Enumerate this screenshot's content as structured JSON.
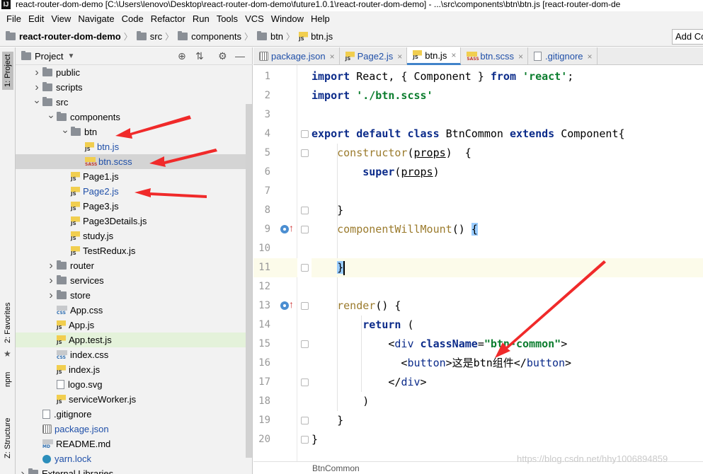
{
  "window": {
    "title": "react-router-dom-demo [C:\\Users\\lenovo\\Desktop\\react-router-dom-demo\\future1.0.1\\react-router-dom-demo] - ...\\src\\components\\btn\\btn.js [react-router-dom-de"
  },
  "menu": [
    "File",
    "Edit",
    "View",
    "Navigate",
    "Code",
    "Refactor",
    "Run",
    "Tools",
    "VCS",
    "Window",
    "Help"
  ],
  "breadcrumb": [
    "react-router-dom-demo",
    "src",
    "components",
    "btn",
    "btn.js"
  ],
  "add_config_label": "Add Co",
  "sidebar_tabs": {
    "project": "1: Project",
    "favorites": "2: Favorites",
    "npm": "npm",
    "structure": "Z: Structure"
  },
  "project_panel": {
    "title": "Project"
  },
  "tree": [
    {
      "label": "public",
      "depth": 1,
      "kind": "folder",
      "arrow": "collapsed"
    },
    {
      "label": "scripts",
      "depth": 1,
      "kind": "folder",
      "arrow": "collapsed"
    },
    {
      "label": "src",
      "depth": 1,
      "kind": "folder",
      "arrow": "expanded"
    },
    {
      "label": "components",
      "depth": 2,
      "kind": "folder",
      "arrow": "expanded"
    },
    {
      "label": "btn",
      "depth": 3,
      "kind": "folder",
      "arrow": "expanded"
    },
    {
      "label": "btn.js",
      "depth": 4,
      "kind": "js",
      "color": "blue"
    },
    {
      "label": "btn.scss",
      "depth": 4,
      "kind": "sass",
      "color": "blue",
      "state": "selected"
    },
    {
      "label": "Page1.js",
      "depth": 3,
      "kind": "js"
    },
    {
      "label": "Page2.js",
      "depth": 3,
      "kind": "js",
      "color": "blue"
    },
    {
      "label": "Page3.js",
      "depth": 3,
      "kind": "js"
    },
    {
      "label": "Page3Details.js",
      "depth": 3,
      "kind": "js"
    },
    {
      "label": "study.js",
      "depth": 3,
      "kind": "js"
    },
    {
      "label": "TestRedux.js",
      "depth": 3,
      "kind": "js"
    },
    {
      "label": "router",
      "depth": 2,
      "kind": "folder",
      "arrow": "collapsed"
    },
    {
      "label": "services",
      "depth": 2,
      "kind": "folder",
      "arrow": "collapsed"
    },
    {
      "label": "store",
      "depth": 2,
      "kind": "folder",
      "arrow": "collapsed"
    },
    {
      "label": "App.css",
      "depth": 2,
      "kind": "css"
    },
    {
      "label": "App.js",
      "depth": 2,
      "kind": "js"
    },
    {
      "label": "App.test.js",
      "depth": 2,
      "kind": "js",
      "state": "highlight"
    },
    {
      "label": "index.css",
      "depth": 2,
      "kind": "css"
    },
    {
      "label": "index.js",
      "depth": 2,
      "kind": "js"
    },
    {
      "label": "logo.svg",
      "depth": 2,
      "kind": "file"
    },
    {
      "label": "serviceWorker.js",
      "depth": 2,
      "kind": "js"
    },
    {
      "label": ".gitignore",
      "depth": 1,
      "kind": "file"
    },
    {
      "label": "package.json",
      "depth": 1,
      "kind": "json",
      "color": "blue"
    },
    {
      "label": "README.md",
      "depth": 1,
      "kind": "md"
    },
    {
      "label": "yarn.lock",
      "depth": 1,
      "kind": "yarn",
      "color": "blue"
    },
    {
      "label": "External Libraries",
      "depth": 0,
      "kind": "folder",
      "arrow": "collapsed"
    }
  ],
  "editor_tabs": [
    {
      "label": "package.json",
      "kind": "json"
    },
    {
      "label": "Page2.js",
      "kind": "js"
    },
    {
      "label": "btn.js",
      "kind": "js",
      "active": true
    },
    {
      "label": "btn.scss",
      "kind": "sass"
    },
    {
      "label": ".gitignore",
      "kind": "file"
    }
  ],
  "code": {
    "current_line": 11,
    "line_numbers": [
      "1",
      "2",
      "3",
      "4",
      "5",
      "6",
      "7",
      "8",
      "9",
      "10",
      "11",
      "12",
      "13",
      "14",
      "15",
      "16",
      "17",
      "18",
      "19",
      "20"
    ],
    "lines": [
      [
        {
          "t": "import",
          "c": "kw"
        },
        {
          "t": " React, { Component } ",
          "c": ""
        },
        {
          "t": "from",
          "c": "kw"
        },
        {
          "t": " ",
          "c": ""
        },
        {
          "t": "'react'",
          "c": "str"
        },
        {
          "t": ";",
          "c": ""
        }
      ],
      [
        {
          "t": "import",
          "c": "kw"
        },
        {
          "t": " ",
          "c": ""
        },
        {
          "t": "'./btn.scss'",
          "c": "str"
        }
      ],
      [],
      [
        {
          "t": "export default class",
          "c": "kw"
        },
        {
          "t": " BtnCommon ",
          "c": ""
        },
        {
          "t": "extends",
          "c": "kw"
        },
        {
          "t": " Component{",
          "c": ""
        }
      ],
      [
        {
          "t": "    ",
          "c": ""
        },
        {
          "t": "constructor",
          "c": "fn"
        },
        {
          "t": "(",
          "c": ""
        },
        {
          "t": "props",
          "c": "param"
        },
        {
          "t": ")  {",
          "c": ""
        }
      ],
      [
        {
          "t": "        ",
          "c": ""
        },
        {
          "t": "super",
          "c": "kw"
        },
        {
          "t": "(",
          "c": ""
        },
        {
          "t": "props",
          "c": "param"
        },
        {
          "t": ")",
          "c": ""
        }
      ],
      [],
      [
        {
          "t": "    }",
          "c": ""
        }
      ],
      [
        {
          "t": "    ",
          "c": ""
        },
        {
          "t": "componentWillMount",
          "c": "fn"
        },
        {
          "t": "() ",
          "c": ""
        },
        {
          "t": "{",
          "c": "br"
        }
      ],
      [],
      [
        {
          "t": "    ",
          "c": ""
        },
        {
          "t": "}",
          "c": "br"
        }
      ],
      [],
      [
        {
          "t": "    ",
          "c": ""
        },
        {
          "t": "render",
          "c": "fn"
        },
        {
          "t": "() {",
          "c": ""
        }
      ],
      [
        {
          "t": "        ",
          "c": ""
        },
        {
          "t": "return",
          "c": "kw"
        },
        {
          "t": " (",
          "c": ""
        }
      ],
      [
        {
          "t": "            <",
          "c": ""
        },
        {
          "t": "div",
          "c": "tag"
        },
        {
          "t": " ",
          "c": ""
        },
        {
          "t": "className",
          "c": "attr"
        },
        {
          "t": "=",
          "c": ""
        },
        {
          "t": "\"btn-common\"",
          "c": "str"
        },
        {
          "t": ">",
          "c": ""
        }
      ],
      [
        {
          "t": "              <",
          "c": ""
        },
        {
          "t": "button",
          "c": "tag"
        },
        {
          "t": ">这是btn组件</",
          "c": ""
        },
        {
          "t": "button",
          "c": "tag"
        },
        {
          "t": ">",
          "c": ""
        }
      ],
      [
        {
          "t": "            </",
          "c": ""
        },
        {
          "t": "div",
          "c": "tag"
        },
        {
          "t": ">",
          "c": ""
        }
      ],
      [
        {
          "t": "        )",
          "c": ""
        }
      ],
      [
        {
          "t": "    }",
          "c": ""
        }
      ],
      [
        {
          "t": "}",
          "c": ""
        }
      ]
    ]
  },
  "footer_crumb": "BtnCommon",
  "watermark": "https://blog.csdn.net/hhy1006894859"
}
